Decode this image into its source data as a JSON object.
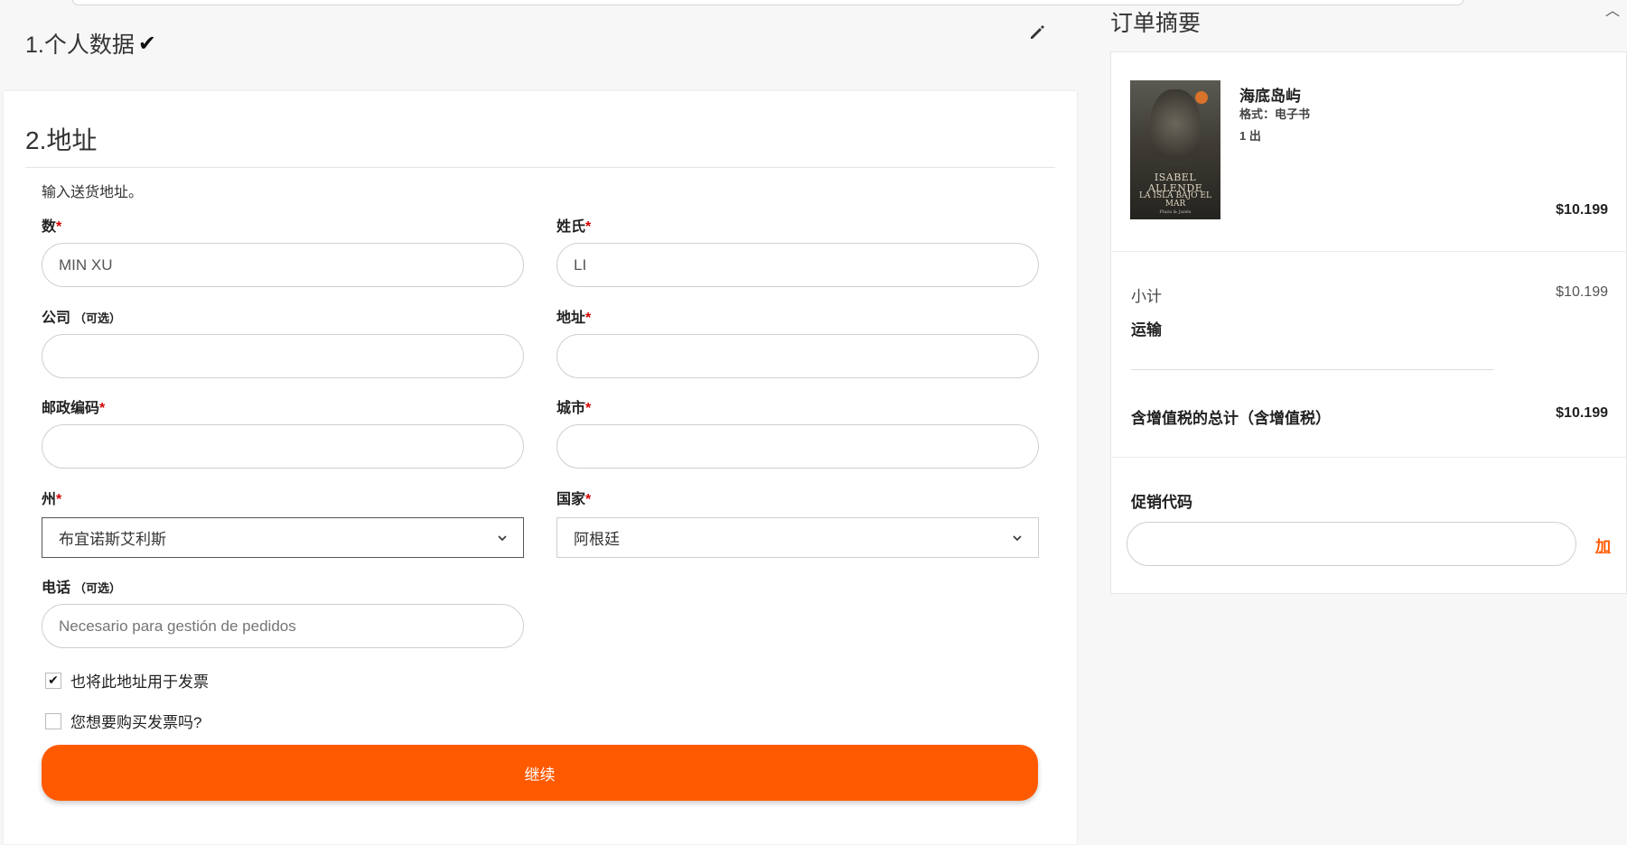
{
  "colors": {
    "accent": "#ff5a00",
    "required": "#d10000"
  },
  "step1": {
    "title": "1.个人数据",
    "check": "✔"
  },
  "step2": {
    "title": "2.地址",
    "intro": "输入送货地址。",
    "fields": {
      "first_name": {
        "label": "数",
        "req": "*",
        "value": "MIN XU"
      },
      "last_name": {
        "label": "姓氏",
        "req": "*",
        "value": "LI"
      },
      "company": {
        "label": "公司",
        "opt": "（可选）",
        "value": ""
      },
      "address": {
        "label": "地址",
        "req": "*",
        "value": ""
      },
      "postcode": {
        "label": "邮政编码",
        "req": "*",
        "value": ""
      },
      "city": {
        "label": "城市",
        "req": "*",
        "value": ""
      },
      "state": {
        "label": "州",
        "req": "*",
        "value": "布宜诺斯艾利斯"
      },
      "country": {
        "label": "国家",
        "req": "*",
        "value": "阿根廷"
      },
      "phone": {
        "label": "电话",
        "opt": "（可选）",
        "placeholder": "Necesario para gestión de pedidos"
      }
    },
    "checkboxes": {
      "billing_same": {
        "label": "也将此地址用于发票",
        "checked_mark": "✔"
      },
      "want_invoice": {
        "label": "您想要购买发票吗?"
      }
    },
    "continue_label": "继续"
  },
  "summary": {
    "title": "订单摘要",
    "product": {
      "title": "海底岛屿",
      "format": "格式：电子书",
      "qty": "1 出",
      "price": "$10.199",
      "cover": {
        "author": "ISABEL ALLENDE",
        "book": "LA ISLA BAJO EL MAR",
        "publisher": "Plaza & Janés"
      }
    },
    "subtotal_label": "小计",
    "subtotal_value": "$10.199",
    "shipping_label": "运输",
    "total_label": "含增值税的总计（含增值税）",
    "total_value": "$10.199",
    "promo_label": "促销代码",
    "promo_add": "加"
  }
}
